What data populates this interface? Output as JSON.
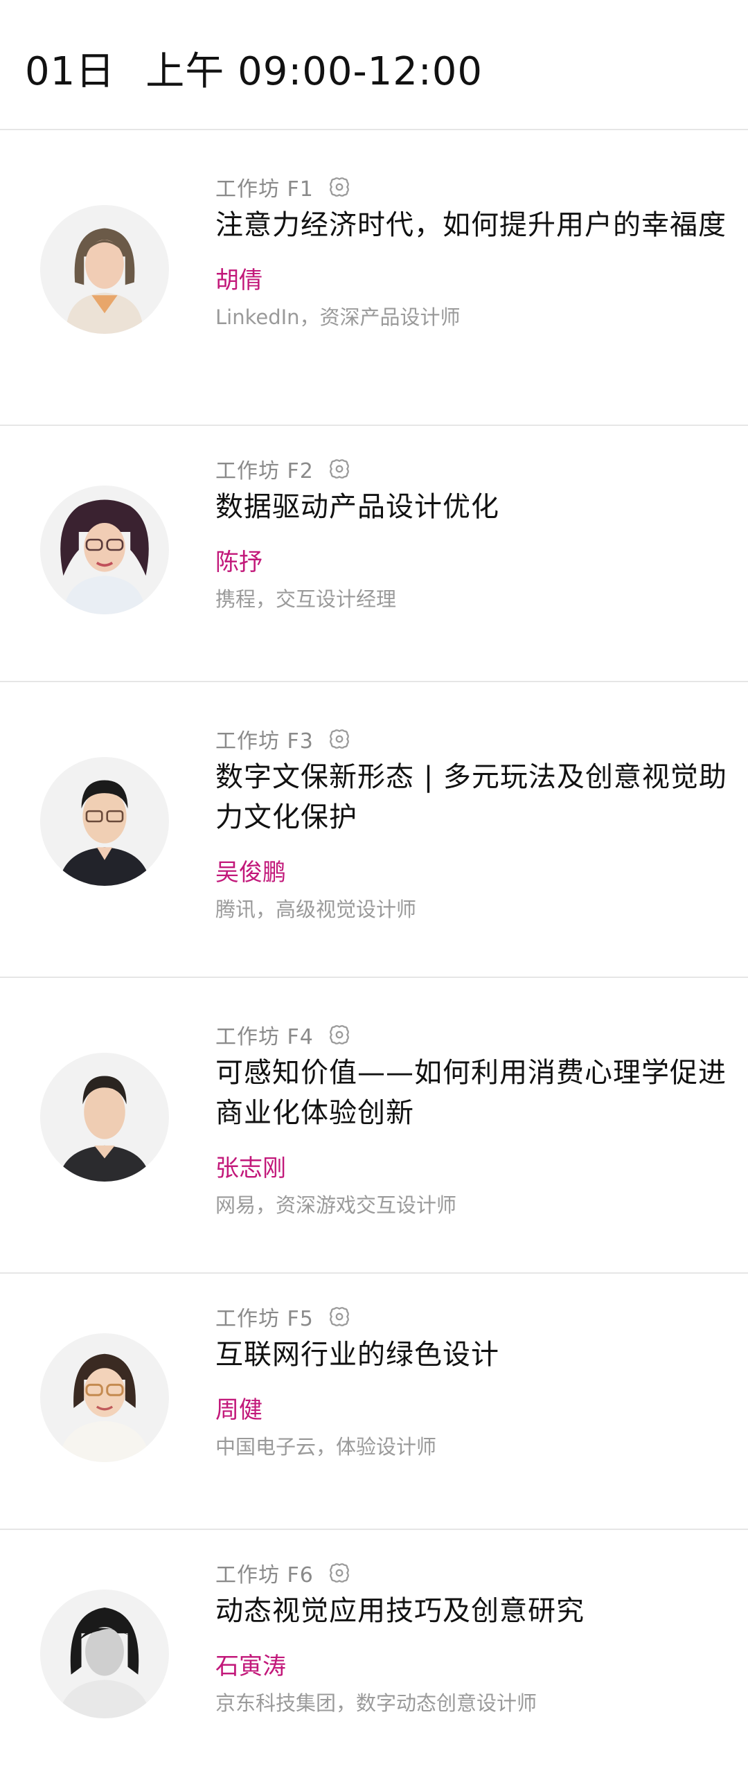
{
  "header": {
    "date": "01日",
    "time": "上午 09:00-12:00"
  },
  "sessions": [
    {
      "tag": "工作坊 F1",
      "title": "注意力经济时代，如何提升用户的幸福度",
      "speaker": "胡倩",
      "role": "LinkedIn，资深产品设计师"
    },
    {
      "tag": "工作坊 F2",
      "title": "数据驱动产品设计优化",
      "speaker": "陈抒",
      "role": "携程，交互设计经理"
    },
    {
      "tag": "工作坊 F3",
      "title": "数字文保新形态 | 多元玩法及创意视觉助力文化保护",
      "speaker": "吴俊鹏",
      "role": "腾讯，高级视觉设计师"
    },
    {
      "tag": "工作坊 F4",
      "title": "可感知价值——如何利用消费心理学促进商业化体验创新",
      "speaker": "张志刚",
      "role": "网易，资深游戏交互设计师"
    },
    {
      "tag": "工作坊 F5",
      "title": "互联网行业的绿色设计",
      "speaker": "周健",
      "role": "中国电子云，体验设计师"
    },
    {
      "tag": "工作坊 F6",
      "title": "动态视觉应用技巧及创意研究",
      "speaker": "石寅涛",
      "role": "京东科技集团，数字动态创意设计师"
    }
  ],
  "icons": {
    "workshop": "workshop-icon"
  },
  "colors": {
    "speaker": "#c2187a",
    "muted": "#9a9a9a",
    "divider": "#e6e6e6"
  }
}
